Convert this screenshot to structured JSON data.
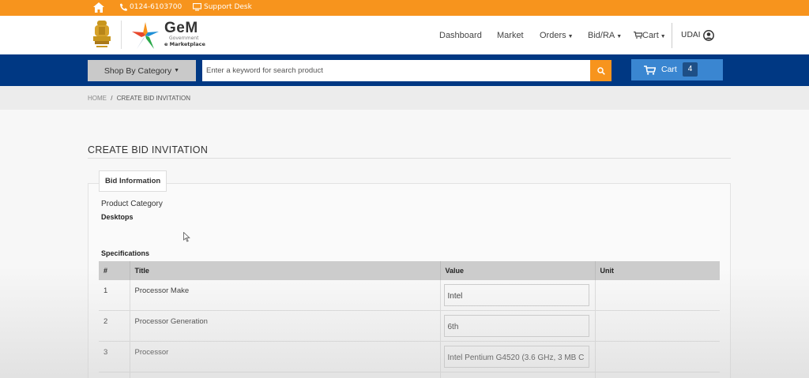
{
  "topbar": {
    "phone": "0124-6103700",
    "support": "Support Desk",
    "icons": [
      "home-icon",
      "phone-icon",
      "monitor-icon"
    ]
  },
  "header": {
    "logo_title": "GeM",
    "logo_sub1": "Government",
    "logo_sub2": "e Marketplace",
    "nav": {
      "dashboard": "Dashboard",
      "market": "Market",
      "orders": "Orders",
      "bidra": "Bid/RA",
      "cart": "Cart"
    },
    "user": "UDAI"
  },
  "searchbar": {
    "shop_label": "Shop By Category",
    "placeholder": "Enter a keyword for search product",
    "cart_label": "Cart",
    "cart_count": "4"
  },
  "breadcrumb": {
    "home": "HOME",
    "separator": "/",
    "current": "CREATE BID INVITATION"
  },
  "page": {
    "title": "CREATE BID INVITATION",
    "tab": "Bid Information",
    "product_category_label": "Product Category",
    "product_category_value": "Desktops",
    "specifications_label": "Specifications"
  },
  "table": {
    "headers": {
      "num": "#",
      "title": "Title",
      "value": "Value",
      "unit": "Unit"
    },
    "rows": [
      {
        "num": "1",
        "title": "Processor Make",
        "value": "Intel",
        "unit": ""
      },
      {
        "num": "2",
        "title": "Processor Generation",
        "value": "6th",
        "unit": ""
      },
      {
        "num": "3",
        "title": "Processor",
        "value": "Intel Pentium G4520 (3.6 GHz, 3 MB C",
        "unit": ""
      }
    ]
  },
  "colors": {
    "orange": "#f7941d",
    "navy": "#003883",
    "cart_blue": "#3a86d1"
  }
}
